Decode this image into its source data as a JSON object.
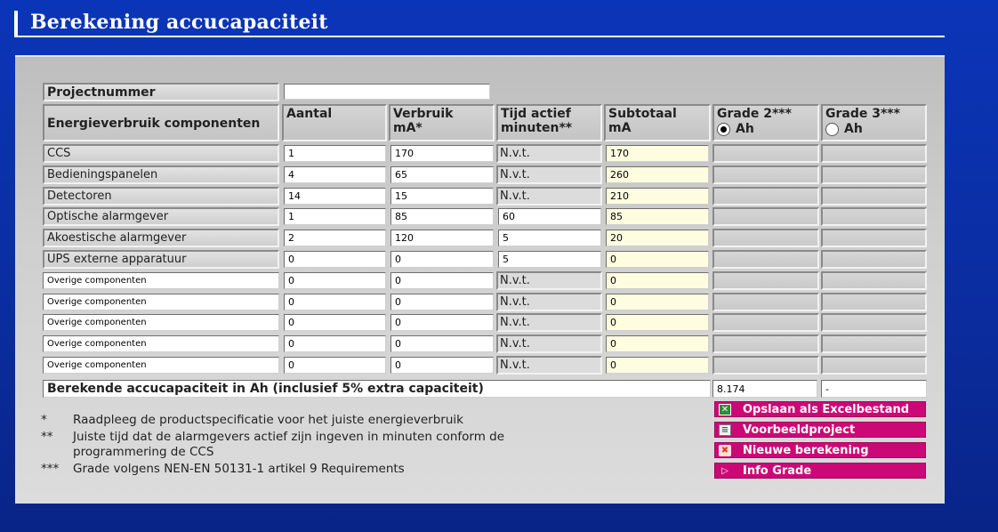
{
  "page_title": "Berekening accucapaciteit",
  "project": {
    "label": "Projectnummer",
    "value": ""
  },
  "header": {
    "component": "Energieverbruik componenten",
    "aantal": "Aantal",
    "verbruik_1": "Verbruik",
    "verbruik_2": "mA*",
    "tijd_1": "Tijd actief",
    "tijd_2": "minuten**",
    "subtotaal_1": "Subtotaal",
    "subtotaal_2": "mA",
    "grade2": "Grade 2***",
    "grade2_unit": "Ah",
    "grade3": "Grade 3***",
    "grade3_unit": "Ah"
  },
  "rows": [
    {
      "name": "CCS",
      "editable_name": false,
      "aantal": "1",
      "verbruik": "170",
      "tijd": "N.v.t.",
      "tijd_input": false,
      "subtotaal": "170"
    },
    {
      "name": "Bedieningspanelen",
      "editable_name": false,
      "aantal": "4",
      "verbruik": "65",
      "tijd": "N.v.t.",
      "tijd_input": false,
      "subtotaal": "260"
    },
    {
      "name": "Detectoren",
      "editable_name": false,
      "aantal": "14",
      "verbruik": "15",
      "tijd": "N.v.t.",
      "tijd_input": false,
      "subtotaal": "210"
    },
    {
      "name": "Optische alarmgever",
      "editable_name": false,
      "aantal": "1",
      "verbruik": "85",
      "tijd": "60",
      "tijd_input": true,
      "subtotaal": "85"
    },
    {
      "name": "Akoestische alarmgever",
      "editable_name": false,
      "aantal": "2",
      "verbruik": "120",
      "tijd": "5",
      "tijd_input": true,
      "subtotaal": "20"
    },
    {
      "name": "UPS externe apparatuur",
      "editable_name": false,
      "aantal": "0",
      "verbruik": "0",
      "tijd": "5",
      "tijd_input": true,
      "subtotaal": "0"
    },
    {
      "name": "Overige componenten",
      "editable_name": true,
      "aantal": "0",
      "verbruik": "0",
      "tijd": "N.v.t.",
      "tijd_input": false,
      "subtotaal": "0"
    },
    {
      "name": "Overige componenten",
      "editable_name": true,
      "aantal": "0",
      "verbruik": "0",
      "tijd": "N.v.t.",
      "tijd_input": false,
      "subtotaal": "0"
    },
    {
      "name": "Overige componenten",
      "editable_name": true,
      "aantal": "0",
      "verbruik": "0",
      "tijd": "N.v.t.",
      "tijd_input": false,
      "subtotaal": "0"
    },
    {
      "name": "Overige componenten",
      "editable_name": true,
      "aantal": "0",
      "verbruik": "0",
      "tijd": "N.v.t.",
      "tijd_input": false,
      "subtotaal": "0"
    },
    {
      "name": "Overige componenten",
      "editable_name": true,
      "aantal": "0",
      "verbruik": "0",
      "tijd": "N.v.t.",
      "tijd_input": false,
      "subtotaal": "0"
    }
  ],
  "total": {
    "label": "Berekende accucapaciteit in Ah (inclusief 5% extra capaciteit)",
    "grade2_value": "8.174",
    "grade3_value": "-"
  },
  "notes": [
    {
      "mark": "*",
      "line1": "Raadpleeg de productspecificatie voor het juiste energieverbruik",
      "line2": ""
    },
    {
      "mark": "**",
      "line1": "Juiste tijd dat de alarmgevers actief zijn ingeven in minuten conform de",
      "line2": "programmering de CCS"
    },
    {
      "mark": "***",
      "line1": "Grade volgens NEN-EN 50131-1 artikel 9 Requirements",
      "line2": ""
    }
  ],
  "buttons": {
    "save_excel": "Opslaan als Excelbestand",
    "example": "Voorbeeldproject",
    "new_calc": "Nieuwe berekening",
    "info_grade": "Info Grade"
  },
  "colors": {
    "background": "#0a2a9c",
    "button": "#cc0877",
    "subtotal_field": "#fffde0"
  }
}
